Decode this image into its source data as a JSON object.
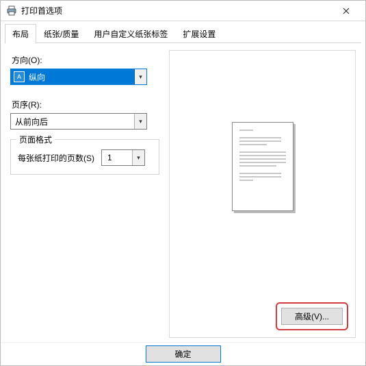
{
  "window": {
    "title": "打印首选项"
  },
  "tabs": [
    {
      "label": "布局",
      "active": true
    },
    {
      "label": "纸张/质量"
    },
    {
      "label": "用户自定义纸张标签"
    },
    {
      "label": "扩展设置"
    }
  ],
  "orientation": {
    "label": "方向(O):",
    "value": "纵向",
    "icon_name": "portrait-page-icon",
    "icon_glyph": "A"
  },
  "page_order": {
    "label": "页序(R):",
    "value": "从前向后"
  },
  "page_format": {
    "legend": "页面格式",
    "pages_per_sheet_label": "每张纸打印的页数(S)",
    "pages_per_sheet_value": "1"
  },
  "buttons": {
    "advanced": "高级(V)...",
    "ok": "确定"
  },
  "colors": {
    "highlight_box": "#d23c3c",
    "selection_bg": "#0078d7"
  }
}
